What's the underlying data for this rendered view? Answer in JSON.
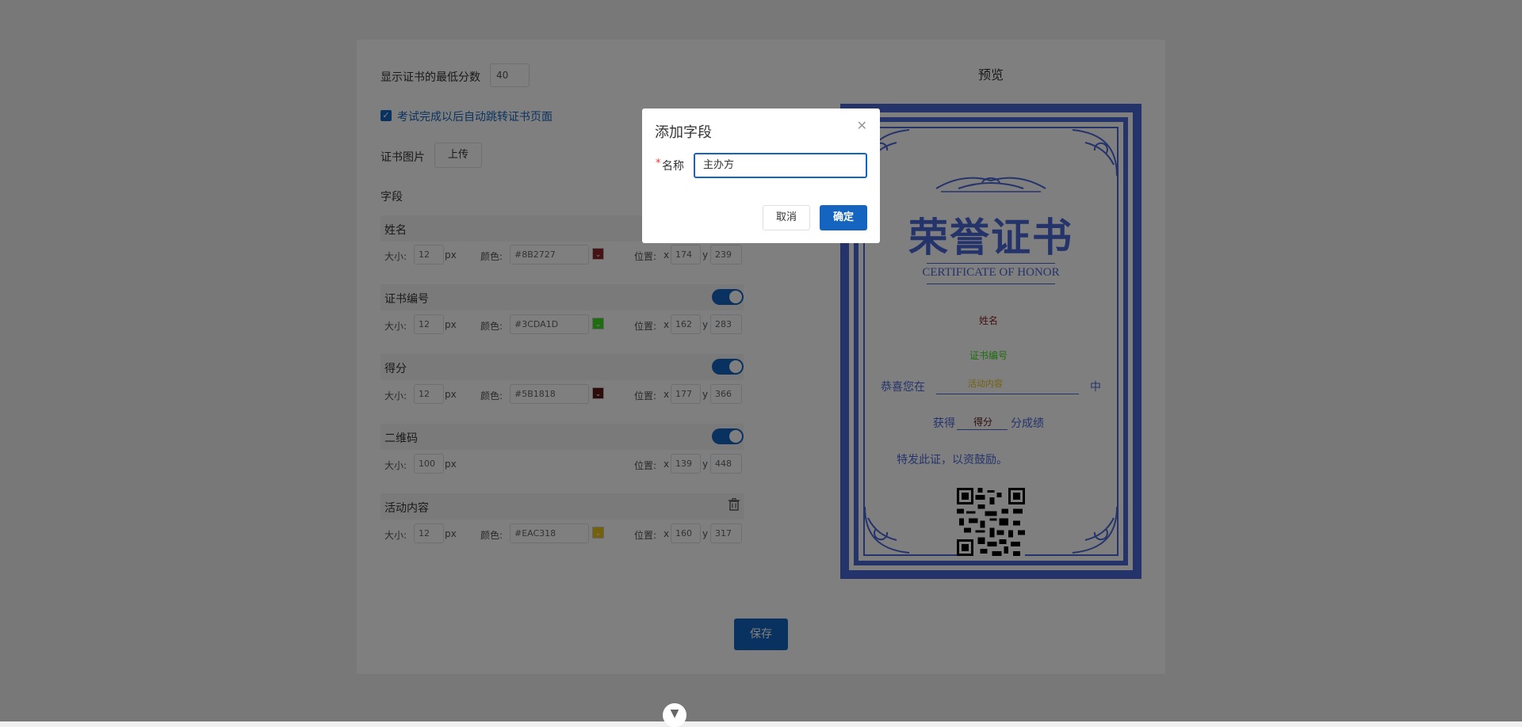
{
  "form": {
    "min_score_label": "显示证书的最低分数",
    "min_score_value": "40",
    "auto_redirect_label": "考试完成以后自动跳转证书页面",
    "auto_redirect_checked": true,
    "cert_image_label": "证书图片",
    "upload_label": "上传",
    "fields_label": "字段",
    "save_label": "保存"
  },
  "labels": {
    "size": "大小:",
    "px": "px",
    "color": "颜色:",
    "position": "位置:",
    "x": "x",
    "y": "y"
  },
  "fields": [
    {
      "name": "姓名",
      "size": "12",
      "color": "#8B2727",
      "x": "174",
      "y": "239",
      "toggle": false,
      "delete": false
    },
    {
      "name": "证书编号",
      "size": "12",
      "color": "#3CDA1D",
      "x": "162",
      "y": "283",
      "toggle": true,
      "delete": false
    },
    {
      "name": "得分",
      "size": "12",
      "color": "#5B1818",
      "x": "177",
      "y": "366",
      "toggle": true,
      "delete": false
    },
    {
      "name": "二维码",
      "size": "100",
      "color": "",
      "x": "139",
      "y": "448",
      "toggle": true,
      "delete": false
    },
    {
      "name": "活动内容",
      "size": "12",
      "color": "#EAC318",
      "x": "160",
      "y": "317",
      "toggle": false,
      "delete": true
    }
  ],
  "preview": {
    "title": "预览",
    "cert_title": "荣誉证书",
    "cert_subtitle": "CERTIFICATE OF HONOR",
    "name_field": "姓名",
    "number_field": "证书编号",
    "congrats_prefix": "恭喜您在",
    "activity_field": "活动内容",
    "congrats_suffix": "中",
    "score_prefix": "获得",
    "score_field": "得分",
    "score_suffix": "分成绩",
    "issue_text": "特发此证，以资鼓励。",
    "accent": "#4a67d6"
  },
  "dialog": {
    "title": "添加字段",
    "required_mark": "*",
    "field_label": "名称",
    "field_value": "主办方",
    "cancel_label": "取消",
    "ok_label": "确定"
  }
}
